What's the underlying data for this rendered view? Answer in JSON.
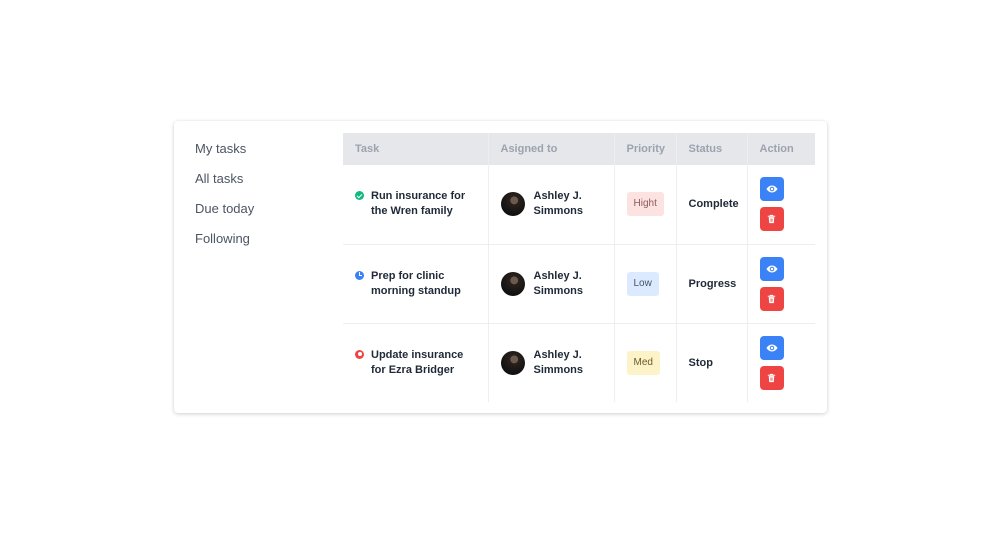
{
  "sidebar": {
    "items": [
      {
        "label": "My tasks"
      },
      {
        "label": "All tasks"
      },
      {
        "label": "Due today"
      },
      {
        "label": "Following"
      }
    ]
  },
  "table": {
    "headers": {
      "task": "Task",
      "assigned": "Asigned to",
      "priority": "Priority",
      "status": "Status",
      "action": "Action"
    },
    "rows": [
      {
        "task": "Run insurance for the Wren family",
        "status_icon": "check-circle-icon",
        "status_icon_color": "#10b981",
        "assignee": "Ashley J. Simmons",
        "priority": "Hight",
        "priority_bg": "#fde2e2",
        "priority_fg": "#8b5a5a",
        "status": "Complete"
      },
      {
        "task": "Prep for clinic morning standup",
        "status_icon": "clock-icon",
        "status_icon_color": "#3b82f6",
        "assignee": "Ashley J. Simmons",
        "priority": "Low",
        "priority_bg": "#dbeafe",
        "priority_fg": "#4b5563",
        "status": "Progress"
      },
      {
        "task": "Update insurance for Ezra Bridger",
        "status_icon": "stop-circle-icon",
        "status_icon_color": "#ef4444",
        "assignee": "Ashley J. Simmons",
        "priority": "Med",
        "priority_bg": "#fdf3c8",
        "priority_fg": "#6b5a2a",
        "status": "Stop"
      }
    ]
  },
  "actions": {
    "view_icon": "eye-icon",
    "delete_icon": "trash-icon",
    "view_color": "#3b82f6",
    "delete_color": "#ef4444"
  }
}
